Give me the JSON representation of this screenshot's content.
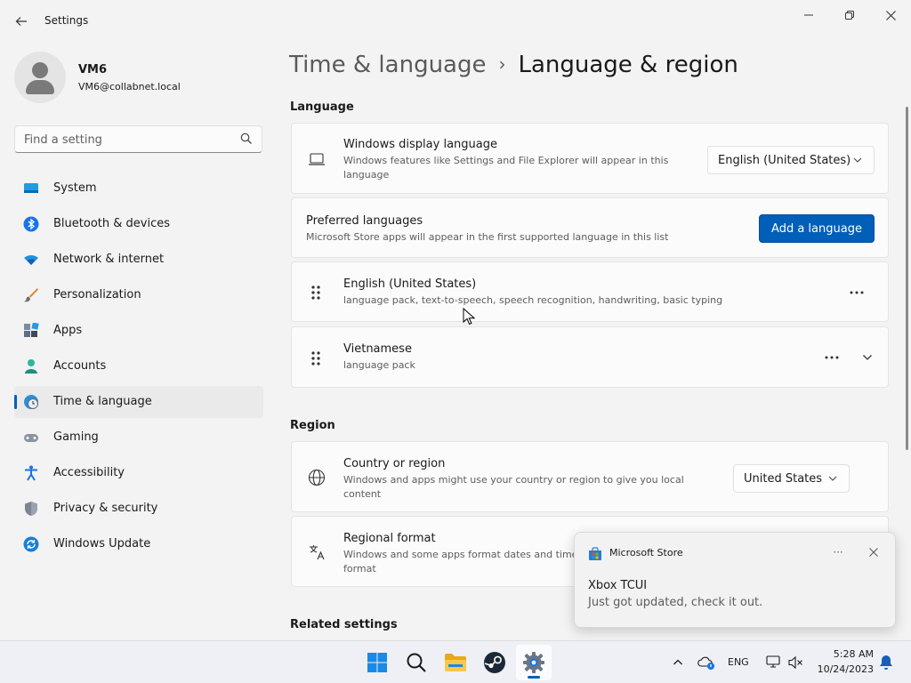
{
  "window": {
    "app_title": "Settings",
    "back_icon": "back-arrow-icon",
    "minimize_icon": "minimize-icon",
    "maximize_icon": "restore-icon",
    "close_icon": "close-icon"
  },
  "profile": {
    "name": "VM6",
    "email": "VM6@collabnet.local"
  },
  "search": {
    "placeholder": "Find a setting",
    "icon": "search-icon"
  },
  "sidebar": {
    "items": [
      {
        "label": "System",
        "icon": "system-icon",
        "active": false
      },
      {
        "label": "Bluetooth & devices",
        "icon": "bluetooth-icon",
        "active": false
      },
      {
        "label": "Network & internet",
        "icon": "wifi-icon",
        "active": false
      },
      {
        "label": "Personalization",
        "icon": "brush-icon",
        "active": false
      },
      {
        "label": "Apps",
        "icon": "apps-icon",
        "active": false
      },
      {
        "label": "Accounts",
        "icon": "accounts-icon",
        "active": false
      },
      {
        "label": "Time & language",
        "icon": "time-language-icon",
        "active": true
      },
      {
        "label": "Gaming",
        "icon": "gamepad-icon",
        "active": false
      },
      {
        "label": "Accessibility",
        "icon": "accessibility-icon",
        "active": false
      },
      {
        "label": "Privacy & security",
        "icon": "shield-icon",
        "active": false
      },
      {
        "label": "Windows Update",
        "icon": "windows-update-icon",
        "active": false
      }
    ]
  },
  "breadcrumb": {
    "parent": "Time & language",
    "separator": "›",
    "current": "Language & region"
  },
  "language_section": {
    "title": "Language",
    "display_language": {
      "title": "Windows display language",
      "subtitle_line1": "Windows features like Settings and File Explorer will appear in this",
      "subtitle_line2": "language",
      "value": "English (United States)",
      "icon": "laptop-icon"
    },
    "preferred": {
      "title": "Preferred languages",
      "subtitle": "Microsoft Store apps will appear in the first supported language in this list",
      "button": "Add a language"
    },
    "languages": [
      {
        "name": "English (United States)",
        "features": "language pack, text-to-speech, speech recognition, handwriting, basic typing"
      },
      {
        "name": "Vietnamese",
        "features": "language pack"
      }
    ]
  },
  "region_section": {
    "title": "Region",
    "country": {
      "title": "Country or region",
      "subtitle_line1": "Windows and apps might use your country or region to give you local",
      "subtitle_line2": "content",
      "value": "United States",
      "icon": "globe-icon"
    },
    "format": {
      "title": "Regional format",
      "subtitle_line1": "Windows and some apps format dates and time",
      "subtitle_line2": "format",
      "icon": "regional-format-icon"
    }
  },
  "related": {
    "title": "Related settings"
  },
  "toast": {
    "app": "Microsoft Store",
    "more": "···",
    "title": "Xbox TCUI",
    "body": "Just got updated, check it out."
  },
  "taskbar": {
    "apps": [
      "windows-start-icon",
      "search-icon",
      "file-explorer-icon",
      "steam-icon",
      "settings-icon"
    ],
    "lang": "ENG",
    "time": "5:28 AM",
    "date": "10/24/2023"
  },
  "colors": {
    "accent": "#005fb8",
    "background": "#f3f3f3",
    "card": "#fbfbfb"
  }
}
